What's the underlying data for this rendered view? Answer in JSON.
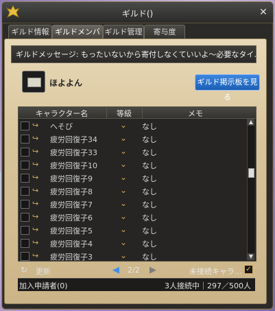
{
  "window": {
    "title": "ギルド()"
  },
  "tabs": [
    {
      "label": "ギルド情報"
    },
    {
      "label": "ギルドメンバー",
      "active": true
    },
    {
      "label": "ギルド管理"
    },
    {
      "label": "寄与度"
    }
  ],
  "guild": {
    "message": "ギルドメッセージ: もったいないから寄付しなくていいよ〜必要なタイ...",
    "name": "ほよよん",
    "board_button": "ギルド掲示板を見る"
  },
  "table": {
    "headers": {
      "character": "キャラクター名",
      "grade": "等級",
      "memo": "メモ"
    },
    "rows": [
      {
        "name": "へそび",
        "memo": "なし"
      },
      {
        "name": "疲労回復子34",
        "memo": "なし"
      },
      {
        "name": "疲労回復子33",
        "memo": "なし"
      },
      {
        "name": "疲労回復子10",
        "memo": "なし"
      },
      {
        "name": "疲労回復子9",
        "memo": "なし"
      },
      {
        "name": "疲労回復子8",
        "memo": "なし"
      },
      {
        "name": "疲労回復子7",
        "memo": "なし"
      },
      {
        "name": "疲労回復子6",
        "memo": "なし"
      },
      {
        "name": "疲労回復子5",
        "memo": "なし"
      },
      {
        "name": "疲労回復子4",
        "memo": "なし"
      },
      {
        "name": "疲労回復子3",
        "memo": "なし"
      }
    ]
  },
  "controls": {
    "refresh": "更新",
    "page": "2/2",
    "offline_label": "未接続キャラ...",
    "offline_checked": true
  },
  "footer": {
    "applicants": "加入申請者(0)",
    "online": "3人接続中｜297／500人"
  },
  "colors": {
    "accent": "#2a6fd0",
    "panel": "#d8c49a"
  }
}
